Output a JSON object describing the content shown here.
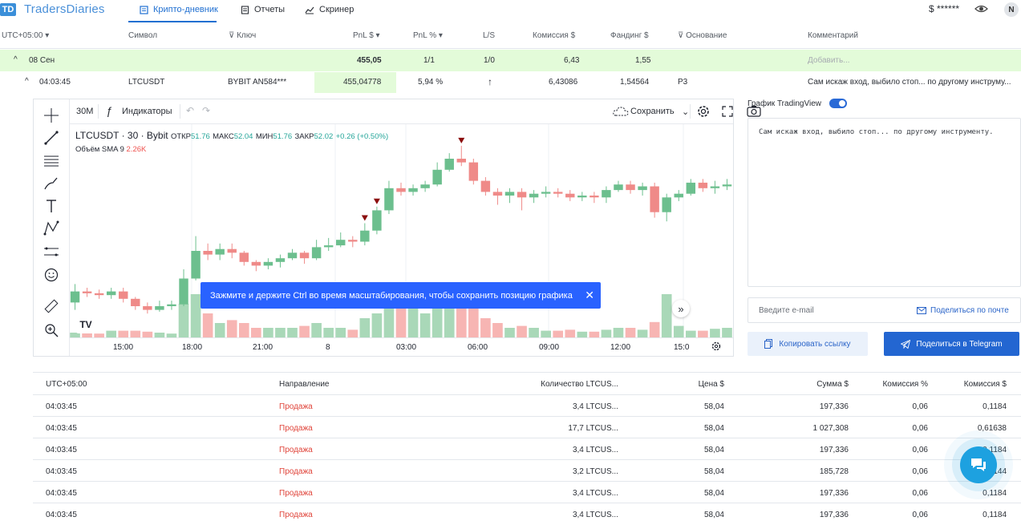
{
  "app": {
    "name": "TradersDiaries",
    "logo_mark": "TD"
  },
  "nav": {
    "tabs": [
      {
        "label": "Крипто-дневник",
        "icon": "journal-icon"
      },
      {
        "label": "Отчеты",
        "icon": "report-icon"
      },
      {
        "label": "Скринер",
        "icon": "screener-icon"
      }
    ],
    "balance": "$ ******",
    "avatar": "N"
  },
  "table_header": {
    "timezone": "UTC+05:00",
    "symbol": "Символ",
    "key": "Ключ",
    "pnl_usd": "PnL $",
    "pnl_pct": "PnL %",
    "ls": "L/S",
    "commission": "Комиссия $",
    "funding": "Фандинг $",
    "reason": "Основание",
    "comment": "Комментарий"
  },
  "group": {
    "date": "08 Сен",
    "pnl": "455,05",
    "pnl_pct": "1/1",
    "ls": "1/0",
    "commission": "6,43",
    "funding": "1,55",
    "comment_placeholder": "Добавить..."
  },
  "trade": {
    "time": "04:03:45",
    "symbol": "LTCUSDT",
    "key": "BYBIT AN584***",
    "pnl": "455,04778",
    "pnl_pct": "5,94 %",
    "direction_arrow": "↑",
    "commission": "6,43086",
    "funding": "1,54564",
    "reason": "Р3",
    "comment": "Сам искаж вход, выбило стоп... по другому инструму..."
  },
  "chart_toolbar": {
    "interval": "30M",
    "indicators": "Индикаторы",
    "save": "Сохранить"
  },
  "chart_legend": {
    "title": "LTCUSDT · 30 · Bybit",
    "open_label": "ОТКР",
    "open": "51.76",
    "high_label": "МАКС",
    "high": "52.04",
    "low_label": "МИН",
    "low": "51.76",
    "close_label": "ЗАКР",
    "close": "52.02",
    "change": "+0.26 (+0.50%)",
    "volume_label": "Объём SMA 9",
    "volume": "2.26K"
  },
  "toast": {
    "text": "Зажмите и держите Ctrl во время масштабирования, чтобы сохранить позицию графика"
  },
  "chart_data": {
    "type": "candlestick",
    "x_ticks": [
      "15:00",
      "18:00",
      "21:00",
      "8",
      "03:00",
      "06:00",
      "09:00",
      "12:00",
      "15:0"
    ],
    "colors": {
      "up": "#26a69a",
      "down": "#ef5350",
      "up_light": "#a9d8b8",
      "down_light": "#f7b5b3"
    },
    "candles": [
      {
        "o": 0.12,
        "c": 0.18,
        "h": 0.22,
        "l": 0.08,
        "v": 0.05
      },
      {
        "o": 0.18,
        "c": 0.17,
        "h": 0.2,
        "l": 0.15,
        "v": 0.05
      },
      {
        "o": 0.17,
        "c": 0.16,
        "h": 0.19,
        "l": 0.14,
        "v": 0.04
      },
      {
        "o": 0.16,
        "c": 0.18,
        "h": 0.2,
        "l": 0.14,
        "v": 0.07
      },
      {
        "o": 0.18,
        "c": 0.14,
        "h": 0.2,
        "l": 0.12,
        "v": 0.07
      },
      {
        "o": 0.14,
        "c": 0.1,
        "h": 0.15,
        "l": 0.08,
        "v": 0.07
      },
      {
        "o": 0.1,
        "c": 0.08,
        "h": 0.12,
        "l": 0.06,
        "v": 0.06
      },
      {
        "o": 0.08,
        "c": 0.1,
        "h": 0.13,
        "l": 0.07,
        "v": 0.05
      },
      {
        "o": 0.1,
        "c": 0.11,
        "h": 0.13,
        "l": 0.08,
        "v": 0.04
      },
      {
        "o": 0.11,
        "c": 0.25,
        "h": 0.3,
        "l": 0.1,
        "v": 0.35
      },
      {
        "o": 0.25,
        "c": 0.4,
        "h": 0.48,
        "l": 0.24,
        "v": 0.45
      },
      {
        "o": 0.4,
        "c": 0.38,
        "h": 0.44,
        "l": 0.35,
        "v": 0.25
      },
      {
        "o": 0.38,
        "c": 0.41,
        "h": 0.44,
        "l": 0.35,
        "v": 0.15
      },
      {
        "o": 0.41,
        "c": 0.39,
        "h": 0.44,
        "l": 0.36,
        "v": 0.18
      },
      {
        "o": 0.39,
        "c": 0.34,
        "h": 0.4,
        "l": 0.32,
        "v": 0.15
      },
      {
        "o": 0.34,
        "c": 0.32,
        "h": 0.35,
        "l": 0.29,
        "v": 0.1
      },
      {
        "o": 0.32,
        "c": 0.34,
        "h": 0.36,
        "l": 0.3,
        "v": 0.1
      },
      {
        "o": 0.34,
        "c": 0.36,
        "h": 0.38,
        "l": 0.31,
        "v": 0.1
      },
      {
        "o": 0.36,
        "c": 0.39,
        "h": 0.41,
        "l": 0.35,
        "v": 0.1
      },
      {
        "o": 0.39,
        "c": 0.36,
        "h": 0.4,
        "l": 0.33,
        "v": 0.12
      },
      {
        "o": 0.36,
        "c": 0.42,
        "h": 0.46,
        "l": 0.35,
        "v": 0.15
      },
      {
        "o": 0.42,
        "c": 0.43,
        "h": 0.47,
        "l": 0.4,
        "v": 0.1
      },
      {
        "o": 0.43,
        "c": 0.46,
        "h": 0.5,
        "l": 0.42,
        "v": 0.1
      },
      {
        "o": 0.46,
        "c": 0.45,
        "h": 0.48,
        "l": 0.42,
        "v": 0.08
      },
      {
        "o": 0.45,
        "c": 0.51,
        "h": 0.55,
        "l": 0.43,
        "v": 0.2
      },
      {
        "o": 0.51,
        "c": 0.62,
        "h": 0.64,
        "l": 0.49,
        "v": 0.25
      },
      {
        "o": 0.62,
        "c": 0.74,
        "h": 0.78,
        "l": 0.6,
        "v": 0.4
      },
      {
        "o": 0.74,
        "c": 0.72,
        "h": 0.77,
        "l": 0.7,
        "v": 0.4
      },
      {
        "o": 0.72,
        "c": 0.74,
        "h": 0.76,
        "l": 0.7,
        "v": 0.45
      },
      {
        "o": 0.74,
        "c": 0.76,
        "h": 0.78,
        "l": 0.72,
        "v": 0.25
      },
      {
        "o": 0.76,
        "c": 0.84,
        "h": 0.88,
        "l": 0.75,
        "v": 0.3
      },
      {
        "o": 0.84,
        "c": 0.9,
        "h": 0.93,
        "l": 0.83,
        "v": 0.45
      },
      {
        "o": 0.9,
        "c": 0.88,
        "h": 0.97,
        "l": 0.86,
        "v": 0.4
      },
      {
        "o": 0.88,
        "c": 0.78,
        "h": 0.9,
        "l": 0.76,
        "v": 0.45
      },
      {
        "o": 0.78,
        "c": 0.72,
        "h": 0.8,
        "l": 0.7,
        "v": 0.2
      },
      {
        "o": 0.72,
        "c": 0.7,
        "h": 0.74,
        "l": 0.65,
        "v": 0.15
      },
      {
        "o": 0.7,
        "c": 0.72,
        "h": 0.74,
        "l": 0.66,
        "v": 0.1
      },
      {
        "o": 0.72,
        "c": 0.69,
        "h": 0.74,
        "l": 0.62,
        "v": 0.12
      },
      {
        "o": 0.69,
        "c": 0.71,
        "h": 0.73,
        "l": 0.66,
        "v": 0.1
      },
      {
        "o": 0.71,
        "c": 0.72,
        "h": 0.75,
        "l": 0.69,
        "v": 0.07
      },
      {
        "o": 0.72,
        "c": 0.71,
        "h": 0.74,
        "l": 0.69,
        "v": 0.07
      },
      {
        "o": 0.71,
        "c": 0.69,
        "h": 0.73,
        "l": 0.67,
        "v": 0.08
      },
      {
        "o": 0.69,
        "c": 0.7,
        "h": 0.72,
        "l": 0.67,
        "v": 0.06
      },
      {
        "o": 0.7,
        "c": 0.69,
        "h": 0.72,
        "l": 0.66,
        "v": 0.06
      },
      {
        "o": 0.69,
        "c": 0.73,
        "h": 0.75,
        "l": 0.66,
        "v": 0.08
      },
      {
        "o": 0.73,
        "c": 0.76,
        "h": 0.78,
        "l": 0.72,
        "v": 0.1
      },
      {
        "o": 0.76,
        "c": 0.73,
        "h": 0.78,
        "l": 0.71,
        "v": 0.1
      },
      {
        "o": 0.73,
        "c": 0.75,
        "h": 0.77,
        "l": 0.7,
        "v": 0.08
      },
      {
        "o": 0.75,
        "c": 0.61,
        "h": 0.77,
        "l": 0.58,
        "v": 0.16
      },
      {
        "o": 0.61,
        "c": 0.69,
        "h": 0.71,
        "l": 0.56,
        "v": 0.45
      },
      {
        "o": 0.69,
        "c": 0.71,
        "h": 0.73,
        "l": 0.67,
        "v": 0.12
      },
      {
        "o": 0.71,
        "c": 0.77,
        "h": 0.79,
        "l": 0.7,
        "v": 0.07
      },
      {
        "o": 0.77,
        "c": 0.74,
        "h": 0.79,
        "l": 0.72,
        "v": 0.07
      },
      {
        "o": 0.74,
        "c": 0.75,
        "h": 0.78,
        "l": 0.71,
        "v": 0.09
      },
      {
        "o": 0.75,
        "c": 0.76,
        "h": 0.79,
        "l": 0.73,
        "v": 0.1
      }
    ],
    "sell_markers": [
      24,
      25,
      32
    ],
    "line_hint": "vertical session separators"
  },
  "right_panel": {
    "tv_label": "График TradingView",
    "comment_text": "Сам искаж вход, выбило стоп... по другому инструменту.",
    "email_placeholder": "Введите e-mail",
    "share_email": "Поделиться по почте",
    "copy_link": "Копировать ссылку",
    "share_telegram": "Поделиться в Telegram"
  },
  "exec_table": {
    "headers": {
      "time": "UTC+05:00",
      "direction": "Направление",
      "qty": "Количество LTCUS...",
      "price": "Цена $",
      "sum": "Сумма $",
      "comm_pct": "Комиссия %",
      "comm_usd": "Комиссия $"
    },
    "rows": [
      {
        "time": "04:03:45",
        "direction": "Продажа",
        "qty": "3,4 LTCUS...",
        "price": "58,04",
        "sum": "197,336",
        "comm_pct": "0,06",
        "comm_usd": "0,1184"
      },
      {
        "time": "04:03:45",
        "direction": "Продажа",
        "qty": "17,7 LTCUS...",
        "price": "58,04",
        "sum": "1 027,308",
        "comm_pct": "0,06",
        "comm_usd": "0,61638"
      },
      {
        "time": "04:03:45",
        "direction": "Продажа",
        "qty": "3,4 LTCUS...",
        "price": "58,04",
        "sum": "197,336",
        "comm_pct": "0,06",
        "comm_usd": "0,1184"
      },
      {
        "time": "04:03:45",
        "direction": "Продажа",
        "qty": "3,2 LTCUS...",
        "price": "58,04",
        "sum": "185,728",
        "comm_pct": "0,06",
        "comm_usd": "0,1144"
      },
      {
        "time": "04:03:45",
        "direction": "Продажа",
        "qty": "3,4 LTCUS...",
        "price": "58,04",
        "sum": "197,336",
        "comm_pct": "0,06",
        "comm_usd": "0,1184"
      },
      {
        "time": "04:03:45",
        "direction": "Продажа",
        "qty": "3,4 LTCUS...",
        "price": "58,04",
        "sum": "197,336",
        "comm_pct": "0,06",
        "comm_usd": "0,1184"
      }
    ]
  }
}
